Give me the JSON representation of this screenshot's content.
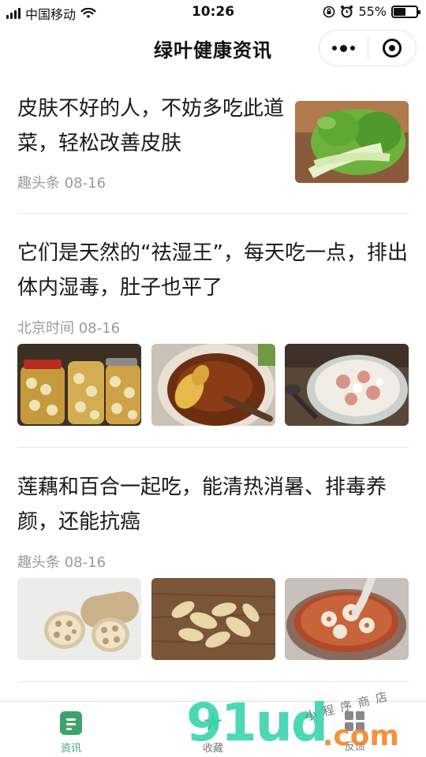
{
  "status_bar": {
    "carrier": "中国移动",
    "time": "10:26",
    "battery_percent": "55%",
    "battery_level": 0.55,
    "icons": [
      "signal-icon",
      "wifi-icon",
      "rotation-lock-icon",
      "alarm-icon",
      "battery-icon"
    ]
  },
  "navbar": {
    "title": "绿叶健康资讯",
    "more_icon": "more-dots-icon",
    "close_icon": "record-target-icon"
  },
  "articles": [
    {
      "title": "皮肤不好的人，不妨多吃此道菜，轻松改善皮肤",
      "source": "趣头条",
      "date": "08-16",
      "meta": "趣头条 08-16",
      "images": [
        "bok-choy-photo"
      ]
    },
    {
      "title": "它们是天然的“祛湿王”，每天吃一点，排出体内湿毒，肚子也平了",
      "source": "北京时间",
      "date": "08-16",
      "meta": "北京时间 08-16",
      "images": [
        "pickled-garlic-jars-photo",
        "ginger-tea-photo",
        "pork-rib-soup-photo"
      ]
    },
    {
      "title": "莲藕和百合一起吃，能清热消暑、排毒养颜，还能抗癌",
      "source": "趣头条",
      "date": "08-16",
      "meta": "趣头条 08-16",
      "images": [
        "lotus-root-photo",
        "dried-lily-bulb-photo",
        "lotus-lily-soup-photo"
      ]
    }
  ],
  "tabbar": {
    "tabs": [
      {
        "label": "资讯",
        "icon": "news-doc-icon",
        "active": true
      },
      {
        "label": "收藏",
        "icon": "star-icon",
        "active": false
      },
      {
        "label": "反馈",
        "icon": "feedback-grid-icon",
        "active": false
      }
    ]
  },
  "watermark": {
    "logo": "91ud",
    "domain": ".com",
    "tagline": "小程序商店"
  },
  "colors": {
    "accent_green": "#3ea36a",
    "meta_gray": "#9a9a9a",
    "divider": "#e6e6e6",
    "watermark_teal": "#3dd4b0",
    "watermark_orange": "#f08a2c"
  }
}
